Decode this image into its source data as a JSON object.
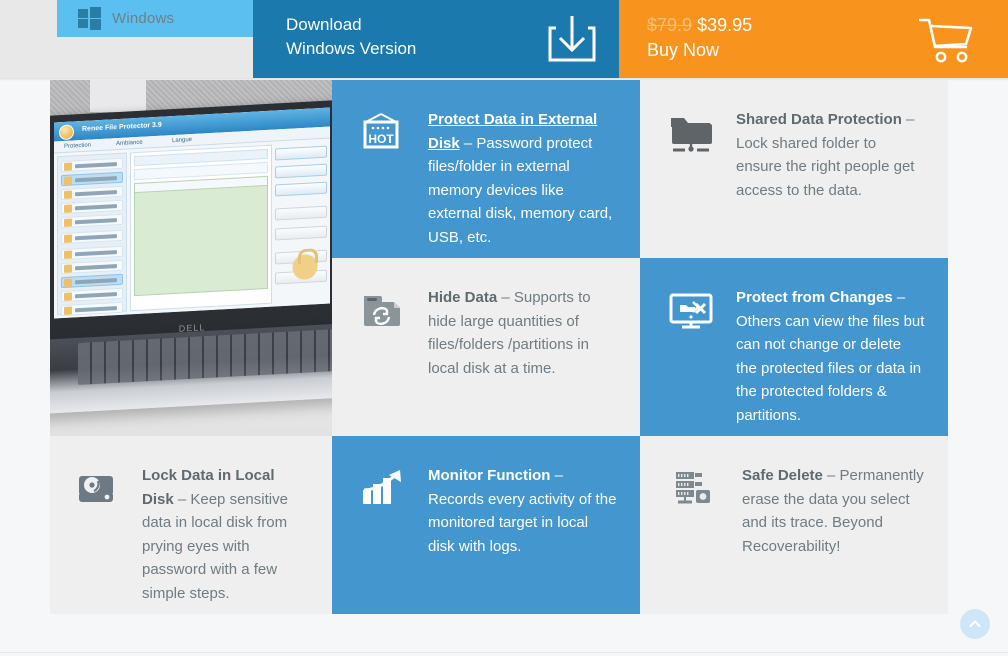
{
  "topbar": {
    "os_tab": {
      "label": "Windows",
      "icon": "windows-logo-icon"
    },
    "download": {
      "line1": "Download",
      "line2": "Windows Version",
      "icon": "download-tray-icon"
    },
    "purchase": {
      "old_price": "$79.9",
      "new_price": "$39.95",
      "buy_label": "Buy Now",
      "icon": "shopping-cart-icon"
    }
  },
  "product_photo": {
    "alt": "Dell laptop showing Renee File Protector software",
    "brand": "DELL",
    "app_title": "Renee File Protector 3.9",
    "menu": [
      "Protection",
      "Ambiance",
      "Langue"
    ]
  },
  "features": [
    {
      "id": "protect-external-disk",
      "icon": "hot-tag-icon",
      "icon_text": "HOT",
      "title": "Protect Data in External Disk",
      "title_style": "hot-link",
      "body": " – Password protect files/folder in external memory devices like external disk, memory card, USB, etc.",
      "theme": "blue"
    },
    {
      "id": "shared-data-protection",
      "icon": "shared-folder-icon",
      "title": "Shared Data Protection",
      "title_style": "blue-link",
      "body": " – Lock shared folder to ensure the right people get access to the data.",
      "theme": "light"
    },
    {
      "id": "hide-data",
      "icon": "hide-folder-icon",
      "title": "Hide Data",
      "title_style": "plain",
      "body": " – Supports to hide large quantities of files/folders /partitions in local disk at a time.",
      "theme": "light"
    },
    {
      "id": "protect-from-changes",
      "icon": "monitor-no-edit-icon",
      "title": "Protect from Changes",
      "title_style": "plain",
      "body": " – Others can view the files but can not change or delete the protected files or data in the protected folders & partitions.",
      "theme": "blue"
    },
    {
      "id": "lock-data-local-disk",
      "icon": "hard-disk-icon",
      "title": "Lock Data in Local Disk",
      "title_style": "plain",
      "body": " – Keep sensitive data in local disk from prying eyes with password with a few simple steps.",
      "theme": "light"
    },
    {
      "id": "monitor-function",
      "icon": "bar-chart-arrow-icon",
      "title": "Monitor Function",
      "title_style": "plain",
      "body": " – Records every activity of the monitored target in local disk with logs.",
      "theme": "blue"
    },
    {
      "id": "safe-delete",
      "icon": "server-rack-icon",
      "title": "Safe Delete",
      "title_style": "plain",
      "body": " – Permanently erase the data you select and its trace. Beyond Recoverability!",
      "theme": "light"
    }
  ],
  "scroll_to_top": {
    "icon": "chevron-up-icon",
    "label": ""
  },
  "colors": {
    "accent_blue": "#4396ce",
    "header_blue": "#1b79ad",
    "tab_blue": "#5bc0f0",
    "orange": "#f8941d",
    "old_price": "#fbc077",
    "light_cell": "#efefef",
    "body_text": "#6f7b82",
    "link_blue": "#4aa3e0"
  }
}
